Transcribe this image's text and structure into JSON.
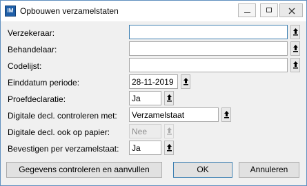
{
  "window": {
    "title": "Opbouwen verzamelstaten",
    "app_icon_text": "IM"
  },
  "labels": {
    "verzekeraar": "Verzekeraar:",
    "behandelaar": "Behandelaar:",
    "codelijst": "Codelijst:",
    "einddatum": "Einddatum periode:",
    "proefdeclaratie": "Proefdeclaratie:",
    "digitale_controleren": "Digitale decl. controleren met:",
    "digitale_papier": "Digitale decl. ook op papier:",
    "bevestigen": "Bevestigen per verzamelstaat:"
  },
  "values": {
    "verzekeraar": "",
    "behandelaar": "",
    "codelijst": "",
    "einddatum": "28-11-2019",
    "proefdeclaratie": "Ja",
    "digitale_controleren": "Verzamelstaat",
    "digitale_papier": "Nee",
    "bevestigen": "Ja"
  },
  "buttons": {
    "gegevens": "Gegevens controleren en aanvullen",
    "ok": "OK",
    "annuleren": "Annuleren"
  }
}
